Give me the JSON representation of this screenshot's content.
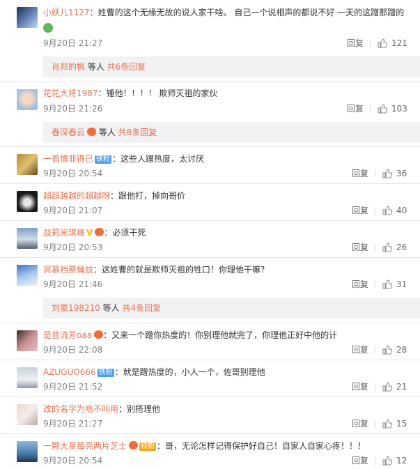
{
  "comments": [
    {
      "name": "小妖儿1127",
      "badge": "",
      "text": "姓曹的这个无缘无故的说人家干啥。 自己一个说相声的都说不好 一天的这蹭那蹭的",
      "time": "9月20日 21:27",
      "reply": "回复",
      "likes": "121"
    },
    {
      "name": "花花大将1987",
      "badge": "",
      "text": "锤他！！！！ 欺师灭祖的家伙",
      "time": "9月20日 21:26",
      "reply": "回复",
      "likes": "103"
    },
    {
      "name": "一首情非得已",
      "badge": "铁粉",
      "text": "这些人蹭热度，太讨厌",
      "time": "9月20日 20:54",
      "reply": "回复",
      "likes": "36"
    },
    {
      "name": "超超越越的超越呀",
      "badge": "",
      "text": "跟他打，掉向哥价",
      "time": "9月20日 21:07",
      "reply": "回复",
      "likes": "40"
    },
    {
      "name": "益莉米琪峰",
      "badge": "",
      "text": "必须干死",
      "time": "9月20日 20:53",
      "reply": "回复",
      "likes": "26"
    },
    {
      "name": "冥慕裆蔡蝇蚊",
      "badge": "",
      "text": "这姓曹的就是欺师灭祖的牲口！你理他干嘛?",
      "time": "9月20日 21:46",
      "reply": "回复",
      "likes": "31"
    },
    {
      "name": "是昔流芳oaa",
      "badge": "",
      "text": "又来一个蹭你热度的！你别理他就完了，你理他正好中他的计",
      "time": "9月20日 22:08",
      "reply": "回复",
      "likes": "28"
    },
    {
      "name": "AZUGUO666",
      "badge": "铁粉",
      "text": "就是蹭热度的，小人一个，佐哥别理他",
      "time": "9月20日 21:52",
      "reply": "回复",
      "likes": "21"
    },
    {
      "name": "改的名字为啥不叫用",
      "badge": "",
      "text": "别搭理他",
      "time": "9月20日 21:27",
      "reply": "回复",
      "likes": "15"
    },
    {
      "name": "一颗大草莓亮两片芝士",
      "badge": "铁粉",
      "text": "哥，无论怎样记得保护好自己！自家人自家心疼！！！",
      "time": "9月20日 20:54",
      "reply": "回复",
      "likes": "12"
    }
  ],
  "more": [
    {
      "user": "肖邦的枫",
      "mid": " 等人 ",
      "link": "共6条回复"
    },
    {
      "user": "春深春云",
      "mid": " 等人 ",
      "link": "共8条回复"
    },
    {
      "user": "刘豪198210",
      "mid": " 等人 ",
      "link": "共4条回复"
    }
  ],
  "colors": {
    "accent": "#eb7350",
    "link_orange": "#eb7350",
    "fan_badge": "#4ca0ec",
    "meta_gray": "#808080",
    "reply_bar_bg": "#f2f2f5"
  },
  "icons": {
    "like": "thumbs-up-icon",
    "vip": "vip-crown-icon",
    "emoji": "smiley-emoji-icon"
  }
}
